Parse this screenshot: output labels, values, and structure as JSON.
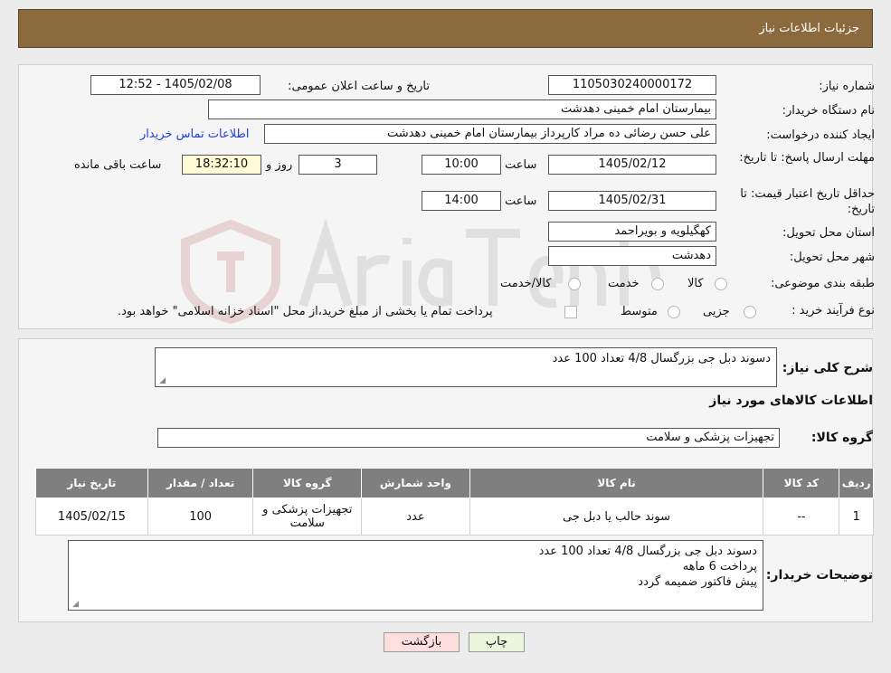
{
  "header": {
    "title": "جزئیات اطلاعات نیاز"
  },
  "need_number": {
    "label": "شماره نیاز:",
    "value": "1105030240000172"
  },
  "announce_date": {
    "label": "تاریخ و ساعت اعلان عمومی:",
    "value": "1405/02/08 - 12:52"
  },
  "buyer_org": {
    "label": "نام دستگاه خریدار:",
    "value": "بیمارستان امام خمینی دهدشت"
  },
  "requester": {
    "label": "ایجاد کننده درخواست:",
    "value": "علی حسن رضائی ده مراد کارپرداز بیمارستان امام خمینی دهدشت",
    "contact_link": "اطلاعات تماس خریدار"
  },
  "reply_deadline": {
    "label": "مهلت ارسال پاسخ: تا تاریخ:",
    "date": "1405/02/12",
    "time_label": "ساعت",
    "time": "10:00",
    "days": "3",
    "days_label": "روز و",
    "remaining": "18:32:10",
    "remaining_label": "ساعت باقی مانده"
  },
  "price_validity": {
    "label": "حداقل تاریخ اعتبار قیمت: تا تاریخ:",
    "date": "1405/02/31",
    "time_label": "ساعت",
    "time": "14:00"
  },
  "province": {
    "label": "استان محل تحویل:",
    "value": "کهگیلویه و بویراحمد"
  },
  "city": {
    "label": "شهر محل تحویل:",
    "value": "دهدشت"
  },
  "category": {
    "label": "طبقه بندی موضوعی:",
    "options": [
      "کالا",
      "خدمت",
      "کالا/خدمت"
    ]
  },
  "purchase_type": {
    "label": "نوع فرآیند خرید :",
    "options": [
      "جزیی",
      "متوسط"
    ],
    "note": "پرداخت تمام یا بخشی از مبلغ خرید،از محل \"اسناد خزانه اسلامی\" خواهد بود."
  },
  "summary": {
    "label": "شرح کلی نیاز:",
    "value": "دسوند دبل جی بزرگسال 4/8 تعداد 100 عدد"
  },
  "items_title": "اطلاعات کالاهای مورد نیاز",
  "goods_group": {
    "label": "گروه کالا:",
    "value": "تجهیزات پزشکی و سلامت"
  },
  "table": {
    "headers": [
      "ردیف",
      "کد کالا",
      "نام کالا",
      "واحد شمارش",
      "گروه کالا",
      "تعداد / مقدار",
      "تاریخ نیاز"
    ],
    "rows": [
      [
        "1",
        "--",
        "سوند حالب یا دبل جی",
        "عدد",
        "تجهیزات پزشکی و سلامت",
        "100",
        "1405/02/15"
      ]
    ]
  },
  "buyer_notes": {
    "label": "توضیحات خریدار:",
    "lines": [
      "دسوند دبل جی بزرگسال 4/8 تعداد 100 عدد",
      "پرداخت 6 ماهه",
      "پیش فاکتور ضمیمه گردد"
    ]
  },
  "buttons": {
    "print": "چاپ",
    "back": "بازگشت"
  },
  "colors": {
    "header_bg": "#8b6a3e",
    "print_btn": "#eaf7dc",
    "back_btn": "#ffdede",
    "link": "#1f3fd6"
  }
}
